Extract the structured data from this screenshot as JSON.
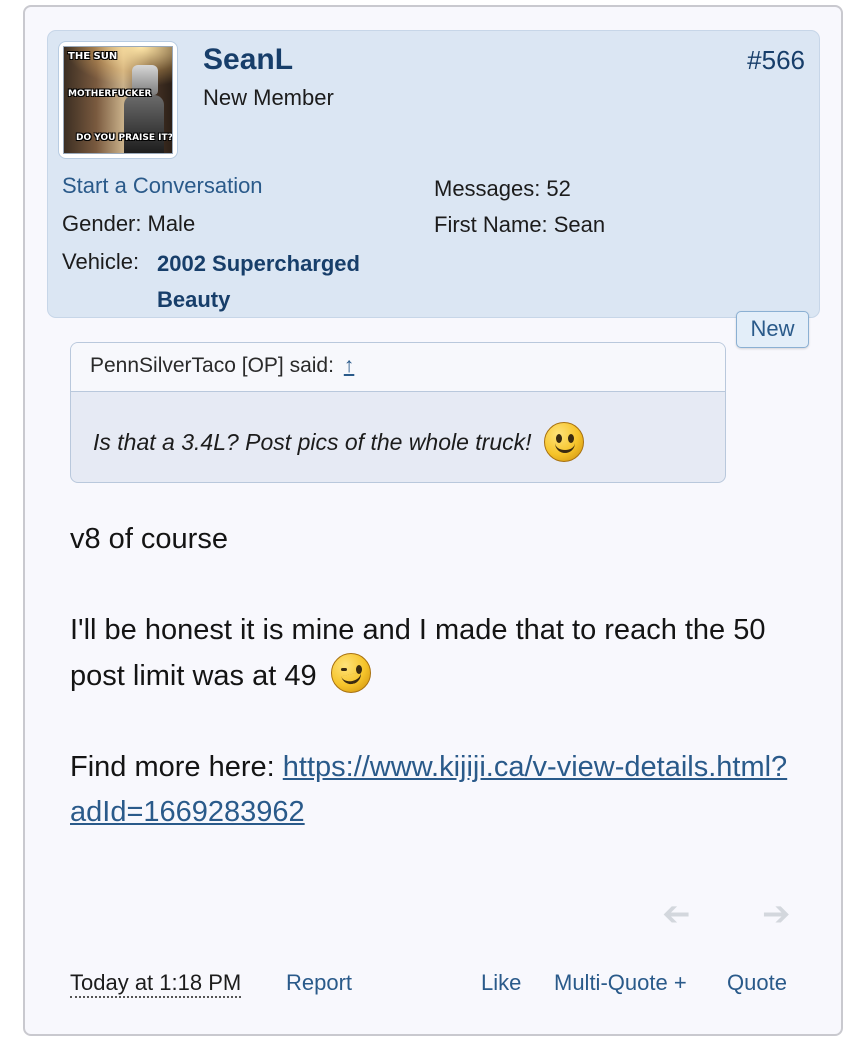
{
  "post": {
    "number": "#566",
    "user": {
      "name": "SeanL",
      "title": "New Member",
      "avatar_text": [
        "THE SUN",
        "MOTHERFUCKER",
        "DO YOU PRAISE IT?"
      ],
      "start_conversation": "Start a Conversation",
      "gender_label": "Gender:",
      "gender": "Male",
      "vehicle_label": "Vehicle:",
      "vehicle": "2002 Supercharged Beauty",
      "messages_label": "Messages:",
      "messages": "52",
      "first_name_label": "First Name:",
      "first_name": "Sean"
    },
    "new_badge": "New",
    "quote": {
      "author": "PennSilverTaco [OP] said:",
      "arrow": "↑",
      "text": "Is that a 3.4L? Post pics of the whole truck!"
    },
    "body": {
      "line1": "v8 of course",
      "line2": "I'll be honest it is mine and I made that to reach the 50 post limit was at 49",
      "line3_prefix": "Find more here:",
      "link": "https://www.kijiji.ca/v-view-details.html?adId=1669283962"
    },
    "footer": {
      "date": "Today at 1:18 PM",
      "report": "Report",
      "like": "Like",
      "multiquote": "Multi-Quote +",
      "quote": "Quote"
    },
    "icons": {
      "prev": "arrow-left-icon",
      "next": "arrow-right-icon",
      "smiley": "smile-icon",
      "wink": "wink-icon"
    },
    "colors": {
      "accent": "#173e6a",
      "link": "#2a5a8a",
      "panel_bg": "#dbe6f3"
    }
  }
}
